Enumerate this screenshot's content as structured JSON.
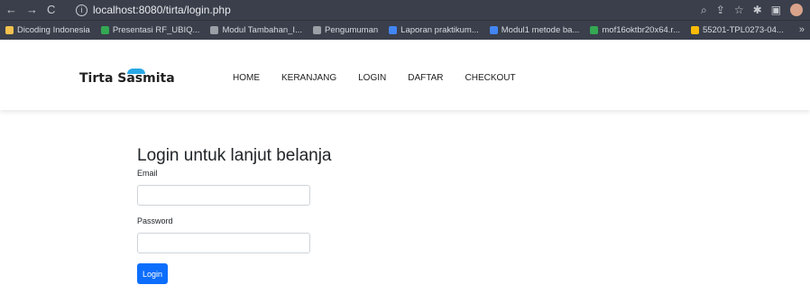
{
  "browser": {
    "url": "localhost:8080/tirta/login.php",
    "nav": {
      "back": "←",
      "forward": "→",
      "reload": "C"
    },
    "bookmarks": [
      {
        "label": "Dicoding Indonesia",
        "color": "#f2c14e"
      },
      {
        "label": "Presentasi RF_UBIQ...",
        "color": "#34a853"
      },
      {
        "label": "Modul Tambahan_I...",
        "color": "#9aa0a6"
      },
      {
        "label": "Pengumuman",
        "color": "#9aa0a6"
      },
      {
        "label": "Laporan praktikum...",
        "color": "#4285f4"
      },
      {
        "label": "Modul1 metode ba...",
        "color": "#4285f4"
      },
      {
        "label": "mof16oktbr20x64.r...",
        "color": "#34a853"
      },
      {
        "label": "55201-TPL0273-04...",
        "color": "#fbbc05"
      }
    ],
    "overflow": "»"
  },
  "site": {
    "brand": "Tirta Sasmita",
    "menu": [
      "HOME",
      "KERANJANG",
      "LOGIN",
      "DAFTAR",
      "CHECKOUT"
    ]
  },
  "login": {
    "title": "Login untuk lanjut belanja",
    "email_label": "Email",
    "email_value": "",
    "password_label": "Password",
    "password_value": "",
    "button": "Login"
  },
  "colors": {
    "primary": "#0d6efd",
    "brand_accent": "#2aa8e6",
    "chrome": "#3a3f4b"
  }
}
